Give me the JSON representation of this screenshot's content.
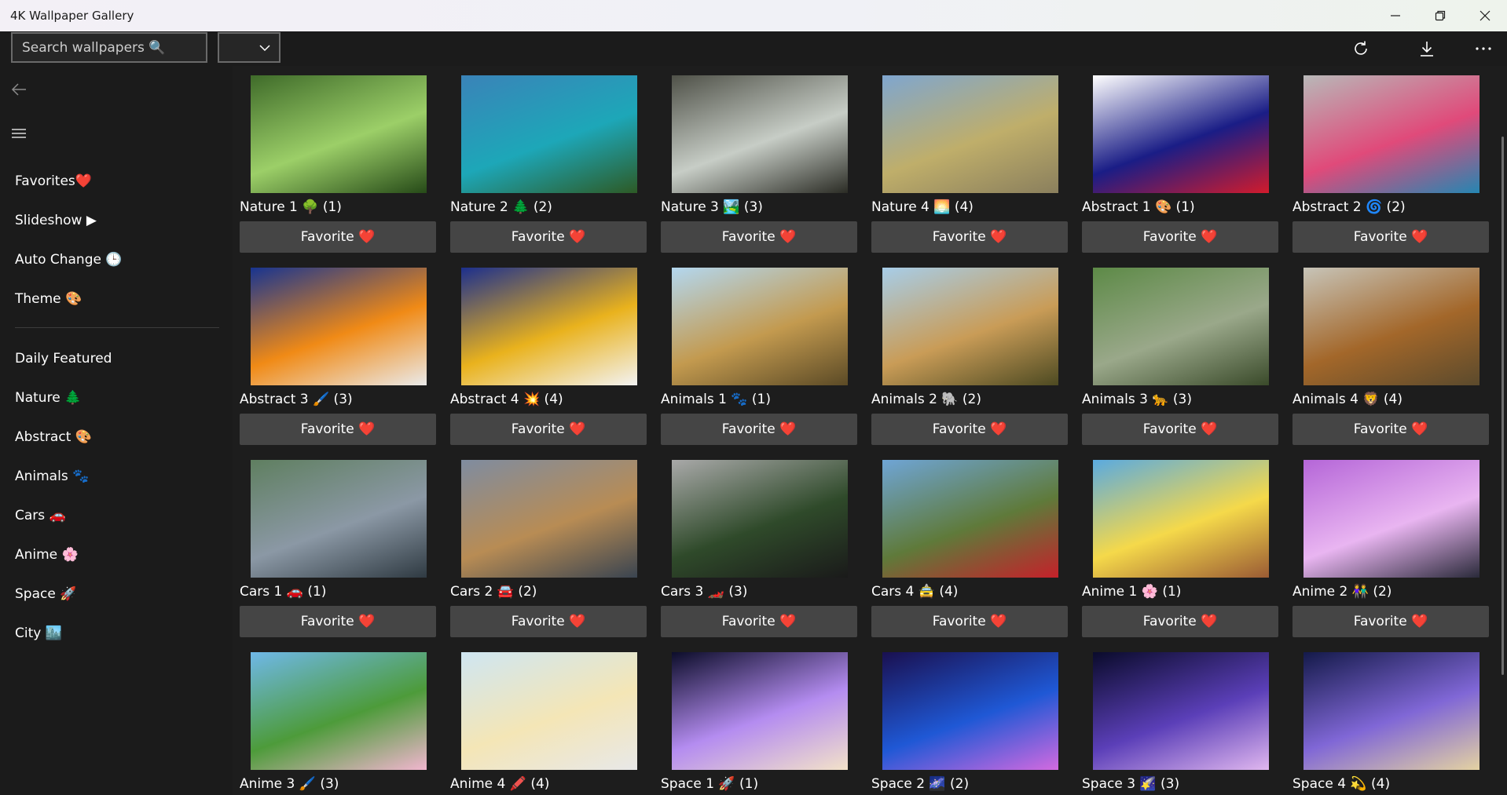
{
  "window": {
    "title": "4K Wallpaper Gallery"
  },
  "toolbar": {
    "search_placeholder": "Search wallpapers 🔍",
    "dropdown_value": ""
  },
  "sidebar": {
    "menu_items": [
      {
        "label": "Favorites❤️"
      },
      {
        "label": "Slideshow ▶"
      },
      {
        "label": "Auto Change 🕒"
      },
      {
        "label": "Theme 🎨"
      }
    ],
    "categories": [
      {
        "label": "Daily Featured"
      },
      {
        "label": "Nature 🌲"
      },
      {
        "label": "Abstract 🎨"
      },
      {
        "label": "Animals 🐾"
      },
      {
        "label": "Cars 🚗"
      },
      {
        "label": "Anime 🌸"
      },
      {
        "label": "Space 🚀"
      },
      {
        "label": "City 🏙️"
      }
    ]
  },
  "gallery": {
    "favorite_label": "Favorite ❤️",
    "items": [
      {
        "caption": "Nature 1 🌳 (1)",
        "colors": [
          "#3f6b2a",
          "#9ccf68",
          "#264a18"
        ]
      },
      {
        "caption": "Nature 2 🌲 (2)",
        "colors": [
          "#3a83b8",
          "#1da7b8",
          "#2d5a25"
        ]
      },
      {
        "caption": "Nature 3 🏞️ (3)",
        "colors": [
          "#4f5148",
          "#c7cdc6",
          "#2b2c25"
        ]
      },
      {
        "caption": "Nature 4 🌅 (4)",
        "colors": [
          "#7fa6cf",
          "#bfae6a",
          "#8a7f5d"
        ]
      },
      {
        "caption": "Abstract 1 🎨 (1)",
        "colors": [
          "#ffffff",
          "#1a1d86",
          "#d21b2c"
        ]
      },
      {
        "caption": "Abstract 2 🌀 (2)",
        "colors": [
          "#b8b8b8",
          "#e04a7a",
          "#2586b2"
        ]
      },
      {
        "caption": "Abstract 3 🖌️ (3)",
        "colors": [
          "#183490",
          "#f08a16",
          "#eaeaea"
        ]
      },
      {
        "caption": "Abstract 4 💥 (4)",
        "colors": [
          "#1c2f8d",
          "#e9b21d",
          "#f3f3f3"
        ]
      },
      {
        "caption": "Animals 1 🐾 (1)",
        "colors": [
          "#b3d7ef",
          "#c39a4f",
          "#5b4a26"
        ]
      },
      {
        "caption": "Animals 2 🐘 (2)",
        "colors": [
          "#a7cde8",
          "#c99c57",
          "#4d4a22"
        ]
      },
      {
        "caption": "Animals 3 🐆 (3)",
        "colors": [
          "#5d8a47",
          "#9aa88a",
          "#3a4a2a"
        ]
      },
      {
        "caption": "Animals 4 🦁 (4)",
        "colors": [
          "#c7c4b8",
          "#a3672a",
          "#5b4a2c"
        ]
      },
      {
        "caption": "Cars 1 🚗 (1)",
        "colors": [
          "#5f7f60",
          "#8b98a5",
          "#2f3a42"
        ]
      },
      {
        "caption": "Cars 2 🚘 (2)",
        "colors": [
          "#7f8ca0",
          "#b88c54",
          "#3a4450"
        ]
      },
      {
        "caption": "Cars 3 🏎️ (3)",
        "colors": [
          "#a9a9a9",
          "#2f4a2a",
          "#1a1a1a"
        ]
      },
      {
        "caption": "Cars 4 🚖 (4)",
        "colors": [
          "#6fa5d6",
          "#5f7a3a",
          "#c4212a"
        ]
      },
      {
        "caption": "Anime 1 🌸 (1)",
        "colors": [
          "#5aaae0",
          "#f5d94a",
          "#9a5b34"
        ]
      },
      {
        "caption": "Anime 2 👫 (2)",
        "colors": [
          "#b566d8",
          "#e9b5f1",
          "#2a2a3a"
        ]
      },
      {
        "caption": "Anime 3 🖌️ (3)",
        "colors": [
          "#6fb8e8",
          "#4d9b3a",
          "#f1b6cf"
        ]
      },
      {
        "caption": "Anime 4 🖍️ (4)",
        "colors": [
          "#cfe6f2",
          "#f4e6b6",
          "#e8e8e8"
        ]
      },
      {
        "caption": "Space 1 🚀 (1)",
        "colors": [
          "#0c0d2a",
          "#b48cf0",
          "#f3e2c9"
        ]
      },
      {
        "caption": "Space 2 🌌 (2)",
        "colors": [
          "#1a1050",
          "#1f58d5",
          "#d36ae0"
        ]
      },
      {
        "caption": "Space 3 🌠 (3)",
        "colors": [
          "#0a0b2b",
          "#5b3fb8",
          "#e0b7ef"
        ]
      },
      {
        "caption": "Space 4 💫 (4)",
        "colors": [
          "#141a4a",
          "#8067d6",
          "#e4d2a2"
        ]
      }
    ]
  }
}
